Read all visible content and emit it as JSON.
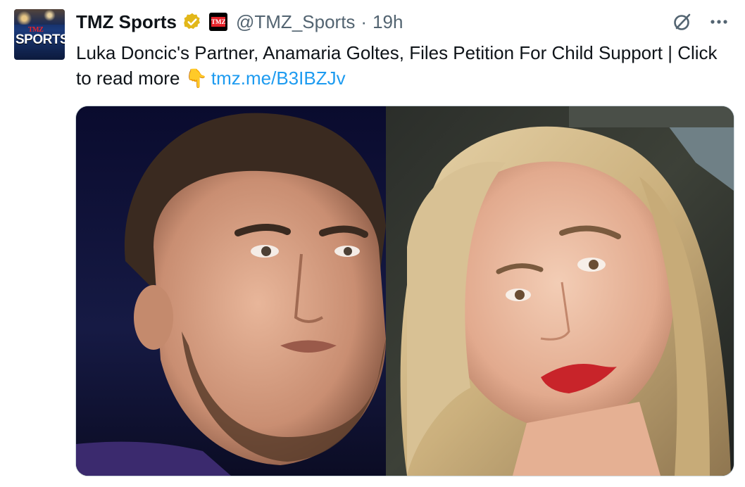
{
  "tweet": {
    "avatar_text": "SPORTS",
    "avatar_small_text": "TMZ",
    "display_name": "TMZ Sports",
    "affiliate_badge_text": "TMZ",
    "handle": "@TMZ_Sports",
    "separator": "·",
    "time": "19h",
    "text_main": "Luka Doncic's Partner, Anamaria Goltes, Files Petition For Child Support  |  Click to read more ",
    "emoji": "👇",
    "link": "tmz.me/B3IBZJv"
  },
  "icons": {
    "verified": "verified-badge-icon",
    "grok": "grok-icon",
    "more": "more-icon"
  },
  "colors": {
    "text": "#0f1419",
    "secondary": "#536471",
    "link": "#1d9bf0",
    "verified": "#e2b719"
  }
}
